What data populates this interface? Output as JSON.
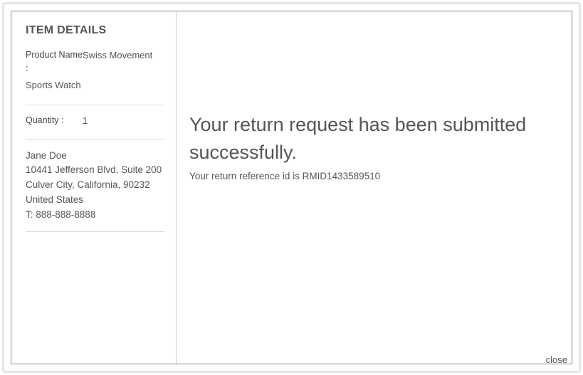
{
  "sidebar": {
    "title": "ITEM DETAILS",
    "product_name_label": "Product Name :",
    "product_name_value_line1": "Swiss Movement",
    "product_name_value_line2": "Sports Watch",
    "quantity_label": "Quantity :",
    "quantity_value": "1",
    "address": {
      "name": "Jane Doe",
      "street": "10441 Jefferson Blvd, Suite 200",
      "city_line": "Culver City, California, 90232",
      "country": "United States",
      "phone": "T: 888-888-8888"
    }
  },
  "main": {
    "success_heading": "Your return request has been submitted successfully.",
    "reference_prefix": "Your return reference id is ",
    "reference_id": "RMID1433589510"
  },
  "footer": {
    "close_label": "close"
  }
}
